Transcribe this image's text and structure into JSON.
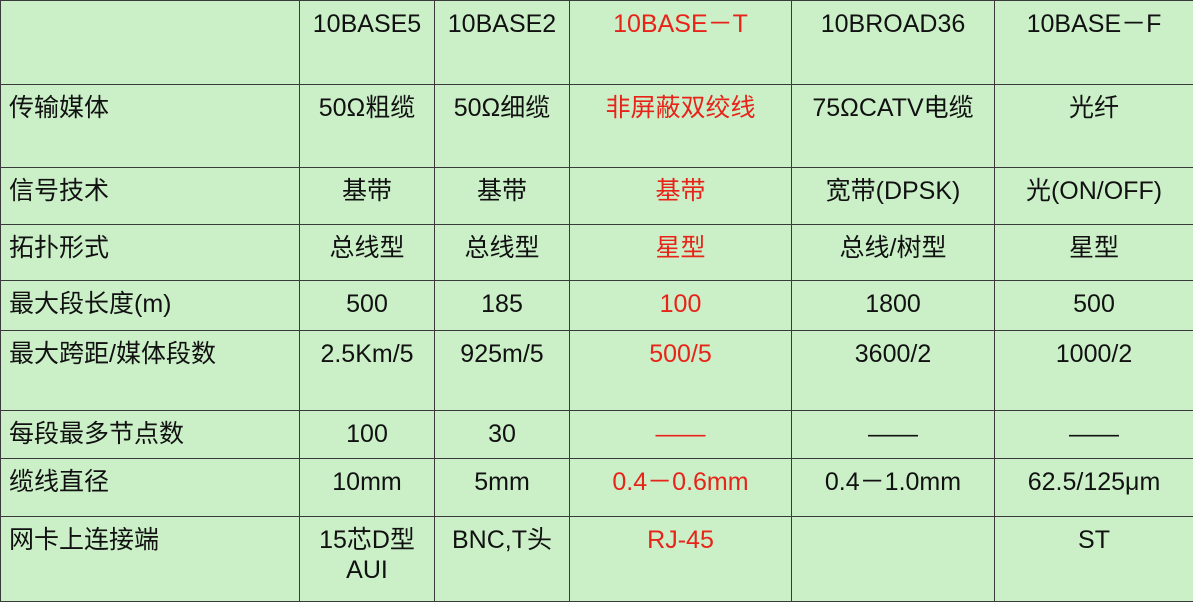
{
  "table": {
    "header": [
      "",
      "10BASE5",
      "10BASE2",
      "10BASE－T",
      "10BROAD36",
      "10BASE－F"
    ],
    "highlight_color": "#e8231a",
    "rows": [
      {
        "label": "传输媒体",
        "cells": [
          "50Ω粗缆",
          "50Ω细缆",
          "非屏蔽双绞线",
          "75ΩCATV电缆",
          "光纤"
        ]
      },
      {
        "label": "信号技术",
        "cells": [
          "基带",
          "基带",
          "基带",
          "宽带(DPSK)",
          "光(ON/OFF)"
        ]
      },
      {
        "label": "拓扑形式",
        "cells": [
          "总线型",
          "总线型",
          "星型",
          "总线/树型",
          "星型"
        ]
      },
      {
        "label": "最大段长度(m)",
        "cells": [
          "500",
          "185",
          "100",
          "1800",
          "500"
        ]
      },
      {
        "label": "最大跨距/媒体段数",
        "cells": [
          "2.5Km/5",
          "925m/5",
          "500/5",
          "3600/2",
          "1000/2"
        ]
      },
      {
        "label": "每段最多节点数",
        "cells": [
          "100",
          "30",
          "——",
          "——",
          "——"
        ]
      },
      {
        "label": "缆线直径",
        "cells": [
          "10mm",
          "5mm",
          "0.4－0.6mm",
          "0.4－1.0mm",
          "62.5/125μm"
        ]
      },
      {
        "label": "网卡上连接端",
        "cells": [
          "15芯D型AUI",
          "BNC,T头",
          "RJ-45",
          "",
          "ST"
        ]
      }
    ]
  }
}
